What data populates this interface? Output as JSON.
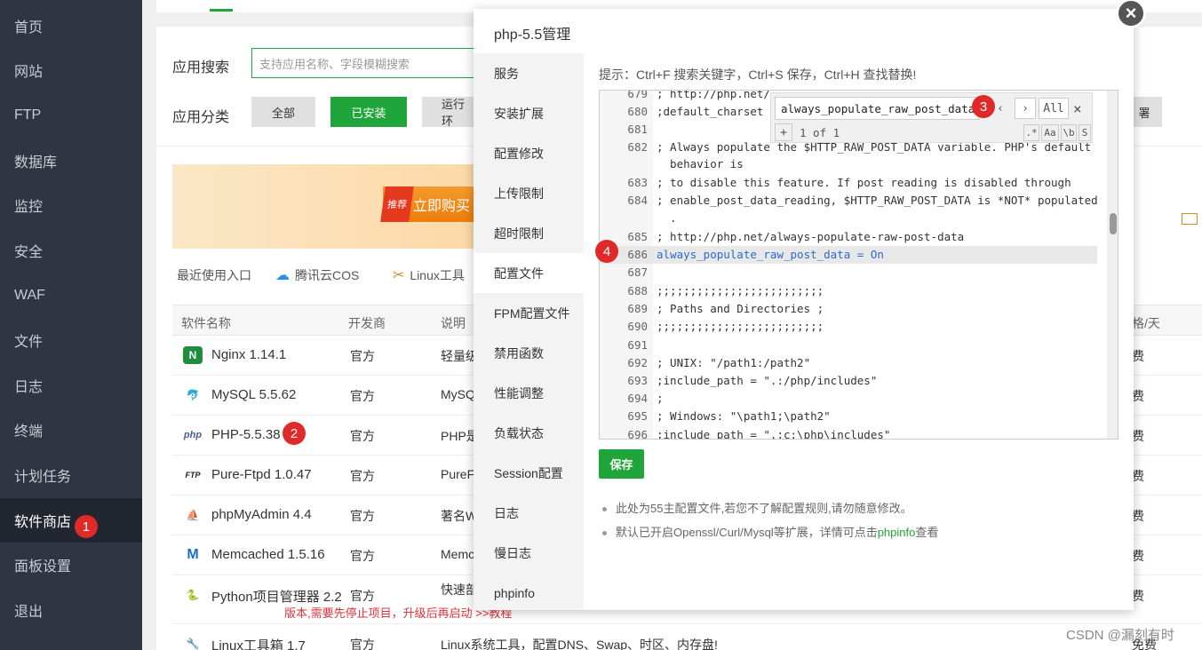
{
  "sidebar": {
    "items": [
      {
        "label": "首页"
      },
      {
        "label": "网站"
      },
      {
        "label": "FTP"
      },
      {
        "label": "数据库"
      },
      {
        "label": "监控"
      },
      {
        "label": "安全"
      },
      {
        "label": "WAF"
      },
      {
        "label": "文件"
      },
      {
        "label": "日志"
      },
      {
        "label": "终端"
      },
      {
        "label": "计划任务"
      },
      {
        "label": "软件商店"
      },
      {
        "label": "面板设置"
      },
      {
        "label": "退出"
      }
    ]
  },
  "store": {
    "search_label": "应用搜索",
    "search_placeholder": "支持应用名称、字段模糊搜索",
    "category_label": "应用分类",
    "categories": [
      "全部",
      "已安装",
      "运行环"
    ],
    "right_btn": "署",
    "banner_hot": "推荐",
    "banner_buy": "立即购买",
    "recent_label": "最近使用入口",
    "recent_items": [
      "腾讯云COS",
      "Linux工具"
    ],
    "table_headers": {
      "name": "软件名称",
      "dev": "开发商",
      "desc": "说明",
      "price": "格/天"
    },
    "rows": [
      {
        "logo": "N",
        "name": "Nginx 1.14.1",
        "dev": "官方",
        "desc": "轻量级",
        "fee": "费"
      },
      {
        "logo": "🐬",
        "name": "MySQL 5.5.62",
        "dev": "官方",
        "desc": "MySQ",
        "fee": "费"
      },
      {
        "logo": "php",
        "name": "PHP-5.5.38",
        "dev": "官方",
        "desc": "PHP是",
        "fee": "费"
      },
      {
        "logo": "FTP",
        "name": "Pure-Ftpd 1.0.47",
        "dev": "官方",
        "desc": "PureF",
        "fee": "费"
      },
      {
        "logo": "⛵",
        "name": "phpMyAdmin 4.4",
        "dev": "官方",
        "desc": "著名W",
        "fee": "费"
      },
      {
        "logo": "M",
        "name": "Memcached 1.5.16",
        "dev": "官方",
        "desc": "Memc",
        "fee": "费"
      },
      {
        "logo": "🐍",
        "name": "Python项目管理器 2.2",
        "dev": "官方",
        "desc": "快速部",
        "fee": "费"
      },
      {
        "logo": "🔧",
        "name": "Linux工具箱 1.7",
        "dev": "官方",
        "desc": "Linux系统工具，配置DNS、Swap、时区、内存盘!",
        "fee": "免费"
      }
    ],
    "warn_text": "版本,需要先停止项目，升级后再启动 >>教程"
  },
  "modal": {
    "title": "php-5.5管理",
    "close": "×",
    "tabs": [
      "服务",
      "安装扩展",
      "配置修改",
      "上传限制",
      "超时限制",
      "配置文件",
      "FPM配置文件",
      "禁用函数",
      "性能调整",
      "负载状态",
      "Session配置",
      "日志",
      "慢日志",
      "phpinfo"
    ],
    "hint": "提示：Ctrl+F 搜索关键字，Ctrl+S 保存，Ctrl+H 查找替换!",
    "code_lines": [
      {
        "n": "679",
        "t": "; http://php.net/"
      },
      {
        "n": "680",
        "t": ";default_charset"
      },
      {
        "n": "681",
        "t": ""
      },
      {
        "n": "682",
        "t": "; Always populate the $HTTP_RAW_POST_DATA variable. PHP's default"
      },
      {
        "n": "",
        "t": "  behavior is"
      },
      {
        "n": "683",
        "t": "; to disable this feature. If post reading is disabled through"
      },
      {
        "n": "684",
        "t": "; enable_post_data_reading, $HTTP_RAW_POST_DATA is *NOT* populated"
      },
      {
        "n": "",
        "t": "  ."
      },
      {
        "n": "685",
        "t": "; http://php.net/always-populate-raw-post-data"
      },
      {
        "n": "686",
        "t": "always_populate_raw_post_data = On"
      },
      {
        "n": "687",
        "t": ""
      },
      {
        "n": "688",
        "t": ";;;;;;;;;;;;;;;;;;;;;;;;;"
      },
      {
        "n": "689",
        "t": "; Paths and Directories ;"
      },
      {
        "n": "690",
        "t": ";;;;;;;;;;;;;;;;;;;;;;;;;"
      },
      {
        "n": "691",
        "t": ""
      },
      {
        "n": "692",
        "t": "; UNIX: \"/path1:/path2\""
      },
      {
        "n": "693",
        "t": ";include_path = \".:/php/includes\""
      },
      {
        "n": "694",
        "t": ";"
      },
      {
        "n": "695",
        "t": "; Windows: \"\\path1;\\path2\""
      },
      {
        "n": "696",
        "t": ";include_path = \".;c:\\php\\includes\""
      }
    ],
    "find": {
      "value": "always_populate_raw_post_data",
      "prev": "‹",
      "next": "›",
      "all": "All",
      "close": "×",
      "plus": "+",
      "count": "1 of 1",
      "opts": [
        ".*",
        "Aa",
        "\\b",
        "S"
      ]
    },
    "save": "保存",
    "notes": [
      "此处为55主配置文件,若您不了解配置规则,请勿随意修改。",
      "默认已开启Openssl/Curl/Mysql等扩展，详情可点击"
    ],
    "note_link": "phpinfo",
    "note_tail": "查看"
  },
  "markers": [
    "1",
    "2",
    "3",
    "4"
  ],
  "watermark": "CSDN @漏刻有时"
}
